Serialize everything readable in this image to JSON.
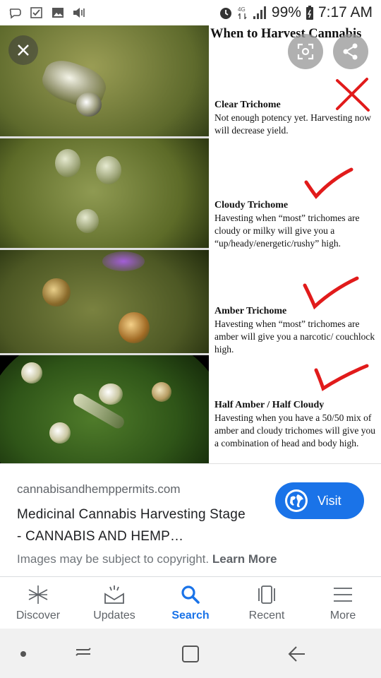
{
  "status_bar": {
    "battery": "99%",
    "time": "7:17 AM",
    "left_icons": [
      "chat-icon",
      "checkbox-icon",
      "image-icon",
      "volume-icon"
    ],
    "right_icons": [
      "alarm-icon",
      "data-icon",
      "signal-icon",
      "battery-icon"
    ]
  },
  "viewer": {
    "heading": "When to Harvest Cannabis",
    "stages": [
      {
        "name": "Clear Trichome",
        "text": "Not enough potency yet.  Harvesting now will decrease yield.",
        "mark": "x"
      },
      {
        "name": "Cloudy Trichome",
        "text": "Havesting when “most” trichomes are cloudy or milky will give you a “up/heady/energetic/rushy” high.",
        "mark": "check"
      },
      {
        "name": "Amber Trichome",
        "text": "Havesting when “most” trichomes are amber will give you a narcotic/ couchlock high.",
        "mark": "check"
      },
      {
        "name": "Half Amber / Half Cloudy",
        "text": "Havesting when you have a 50/50 mix of amber and cloudy trichomes will give you a combination of head and body high.",
        "mark": "check"
      }
    ],
    "mark_color": "#e11b1b"
  },
  "info": {
    "domain": "cannabisandhemppermits.com",
    "title": "Medicinal Cannabis Harvesting Stage - CANNABIS AND HEMP…",
    "visit_label": "Visit",
    "copyright_text": "Images may be subject to copyright.",
    "learn_more": "Learn More",
    "accent": "#1a73e8"
  },
  "app_nav": {
    "tabs": [
      {
        "label": "Discover",
        "icon": "asterisk-icon",
        "active": false
      },
      {
        "label": "Updates",
        "icon": "updates-icon",
        "active": false
      },
      {
        "label": "Search",
        "icon": "search-icon",
        "active": true
      },
      {
        "label": "Recent",
        "icon": "recent-icon",
        "active": false
      },
      {
        "label": "More",
        "icon": "menu-icon",
        "active": false
      }
    ]
  }
}
